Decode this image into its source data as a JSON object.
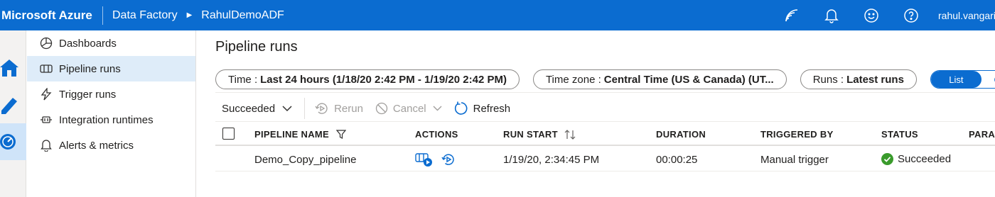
{
  "header": {
    "brand": "Microsoft Azure",
    "service": "Data Factory",
    "factory": "RahulDemoADF",
    "user": "rahul.vangari",
    "icons": [
      "wifi-icon",
      "bell-icon",
      "smiley-icon",
      "help-icon"
    ]
  },
  "rail": {
    "icons": [
      "home-icon",
      "pencil-icon",
      "monitor-icon"
    ]
  },
  "sidebar": {
    "items": [
      {
        "label": "Dashboards",
        "icon": "dashboard-icon"
      },
      {
        "label": "Pipeline runs",
        "icon": "pipeline-icon"
      },
      {
        "label": "Trigger runs",
        "icon": "lightning-icon"
      },
      {
        "label": "Integration runtimes",
        "icon": "runtime-icon"
      },
      {
        "label": "Alerts & metrics",
        "icon": "bell-icon"
      }
    ]
  },
  "main": {
    "title": "Pipeline runs",
    "filters": {
      "time_key": "Time :",
      "time_value": "Last 24 hours (1/18/20 2:42 PM - 1/19/20 2:42 PM)",
      "tz_key": "Time zone :",
      "tz_value": "Central Time (US & Canada) (UT...",
      "runs_key": "Runs :",
      "runs_value": "Latest runs",
      "view_list": "List",
      "view_gantt": "Gantt"
    },
    "toolbar": {
      "status_filter": "Succeeded",
      "rerun": "Rerun",
      "cancel": "Cancel",
      "refresh": "Refresh"
    },
    "table": {
      "headers": [
        "PIPELINE NAME",
        "ACTIONS",
        "RUN START",
        "DURATION",
        "TRIGGERED BY",
        "STATUS",
        "PARA"
      ],
      "rows": [
        {
          "pipeline_name": "Demo_Copy_pipeline",
          "run_start": "1/19/20, 2:34:45 PM",
          "duration": "00:00:25",
          "triggered_by": "Manual trigger",
          "status": "Succeeded"
        }
      ]
    }
  },
  "colors": {
    "accent": "#0b6cd0",
    "success": "#3a9b2c",
    "active_nav": "#deecf9"
  }
}
